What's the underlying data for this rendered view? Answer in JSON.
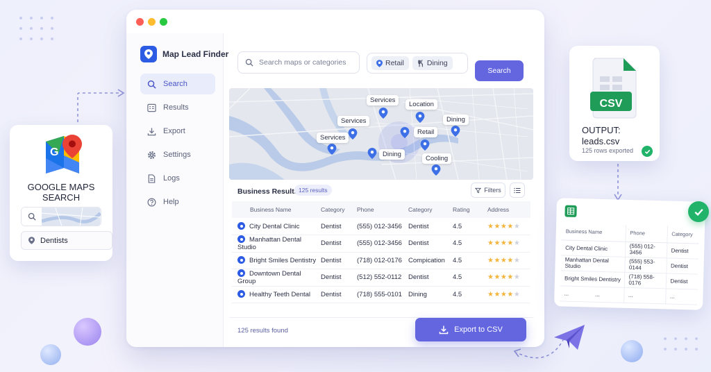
{
  "app": {
    "name": "Map Lead Finder"
  },
  "colors": {
    "accent": "#6466e0",
    "brand": "#2d5be3",
    "success": "#22b36a"
  },
  "sidebar": {
    "items": [
      {
        "label": "Search",
        "icon": "search-icon",
        "active": true
      },
      {
        "label": "Results",
        "icon": "results-icon"
      },
      {
        "label": "Export",
        "icon": "download-icon"
      },
      {
        "label": "Settings",
        "icon": "gear-icon"
      },
      {
        "label": "Logs",
        "icon": "document-icon"
      },
      {
        "label": "Help",
        "icon": "help-icon"
      }
    ]
  },
  "toolbar": {
    "search_placeholder": "Search maps or categories",
    "chips": [
      "Retail",
      "Dining"
    ],
    "search_button": "Search"
  },
  "map": {
    "labels": [
      "Services",
      "Location",
      "Services",
      "Dining",
      "Services",
      "Retail",
      "Dining",
      "Cooling"
    ]
  },
  "results": {
    "title": "Business Results",
    "count_badge": "125 results",
    "filters_label": "Filters",
    "columns": [
      "Business Name",
      "Category",
      "Phone",
      "Category",
      "Rating",
      "Address"
    ],
    "rows": [
      {
        "name": "City Dental Clinic",
        "category": "Dentist",
        "phone": "(555) 012-3456",
        "category2": "Dentist",
        "rating": "4.5",
        "stars": 4
      },
      {
        "name": "Manhattan Dental Studio",
        "category": "Dentist",
        "phone": "(555) 012-3456",
        "category2": "Dentist",
        "rating": "4.5",
        "stars": 4
      },
      {
        "name": "Bright Smiles Dentistry",
        "category": "Dentist",
        "phone": "(718) 012-0176",
        "category2": "Compication",
        "rating": "4.5",
        "stars": 4
      },
      {
        "name": "Downtown Dental Group",
        "category": "Dentist",
        "phone": "(512) 552-0112",
        "category2": "Dentist",
        "rating": "4.5",
        "stars": 4
      },
      {
        "name": "Healthy Teeth Dental",
        "category": "Dentist",
        "phone": "(718) 555-0101",
        "category2": "Dining",
        "rating": "4.5",
        "stars": 4
      }
    ],
    "found_text": "125 results found",
    "export_button": "Export to CSV"
  },
  "input_card": {
    "title_line1": "GOOGLE MAPS",
    "title_line2": "SEARCH",
    "query": "Dentists"
  },
  "output_card": {
    "csv_label": "CSV",
    "line1": "OUTPUT:",
    "line2": "leads.csv",
    "rows_exported": "125 rows exported"
  },
  "sheet": {
    "columns": [
      "Business Name",
      "Phone",
      "Category"
    ],
    "rows": [
      {
        "name": "City Dental Clinic",
        "phone": "(555) 012-3456",
        "category": "Dentist"
      },
      {
        "name": "Manhattan Dental Studio",
        "phone": "(555) 553-0144",
        "category": "Dentist"
      },
      {
        "name": "Bright Smiles Dentistry",
        "phone": "(718) 558-0176",
        "category": "Dentist"
      },
      {
        "name": "...",
        "name2": "...",
        "phone": "...",
        "category": "..."
      }
    ]
  }
}
